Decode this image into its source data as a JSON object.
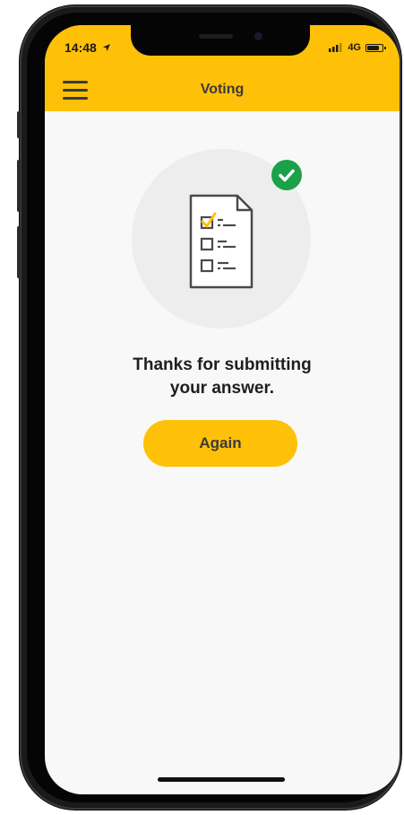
{
  "status_bar": {
    "time": "14:48",
    "location_icon": "location-arrow-icon",
    "signal_icon": "signal-bars-icon",
    "network": "4G",
    "battery_icon": "battery-icon"
  },
  "header": {
    "menu_icon": "hamburger-menu-icon",
    "title": "Voting",
    "background_color": "#ffc107"
  },
  "main": {
    "illustration_icon": "ballot-checklist-icon",
    "success_icon": "check-circle-icon",
    "success_color": "#1aa14a",
    "message": "Thanks for submitting your answer.",
    "again_button_label": "Again"
  }
}
